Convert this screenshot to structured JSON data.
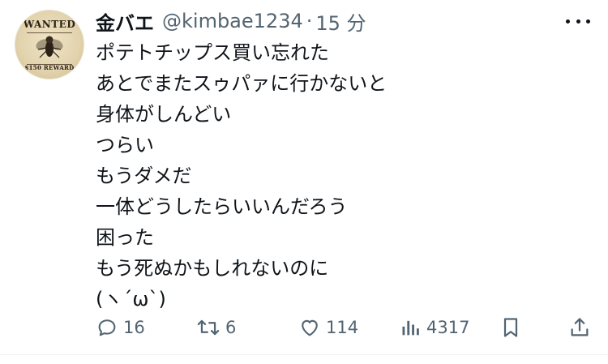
{
  "tweet": {
    "author": {
      "display_name": "金バエ",
      "handle": "@kimbae1234",
      "separator": "·",
      "time": "15 分",
      "avatar_title": "WANTED",
      "avatar_bottom": "$150 REWARD"
    },
    "lines": [
      "ポテトチップス買い忘れた",
      "あとでまたスゥパァに行かないと",
      "身体がしんどい",
      "つらい",
      "もうダメだ",
      "一体どうしたらいいんだろう",
      "困った",
      "もう死ぬかもしれないのに",
      "(ヽ´ω`)"
    ],
    "actions": {
      "replies": "16",
      "retweets": "6",
      "likes": "114",
      "views": "4317"
    }
  }
}
